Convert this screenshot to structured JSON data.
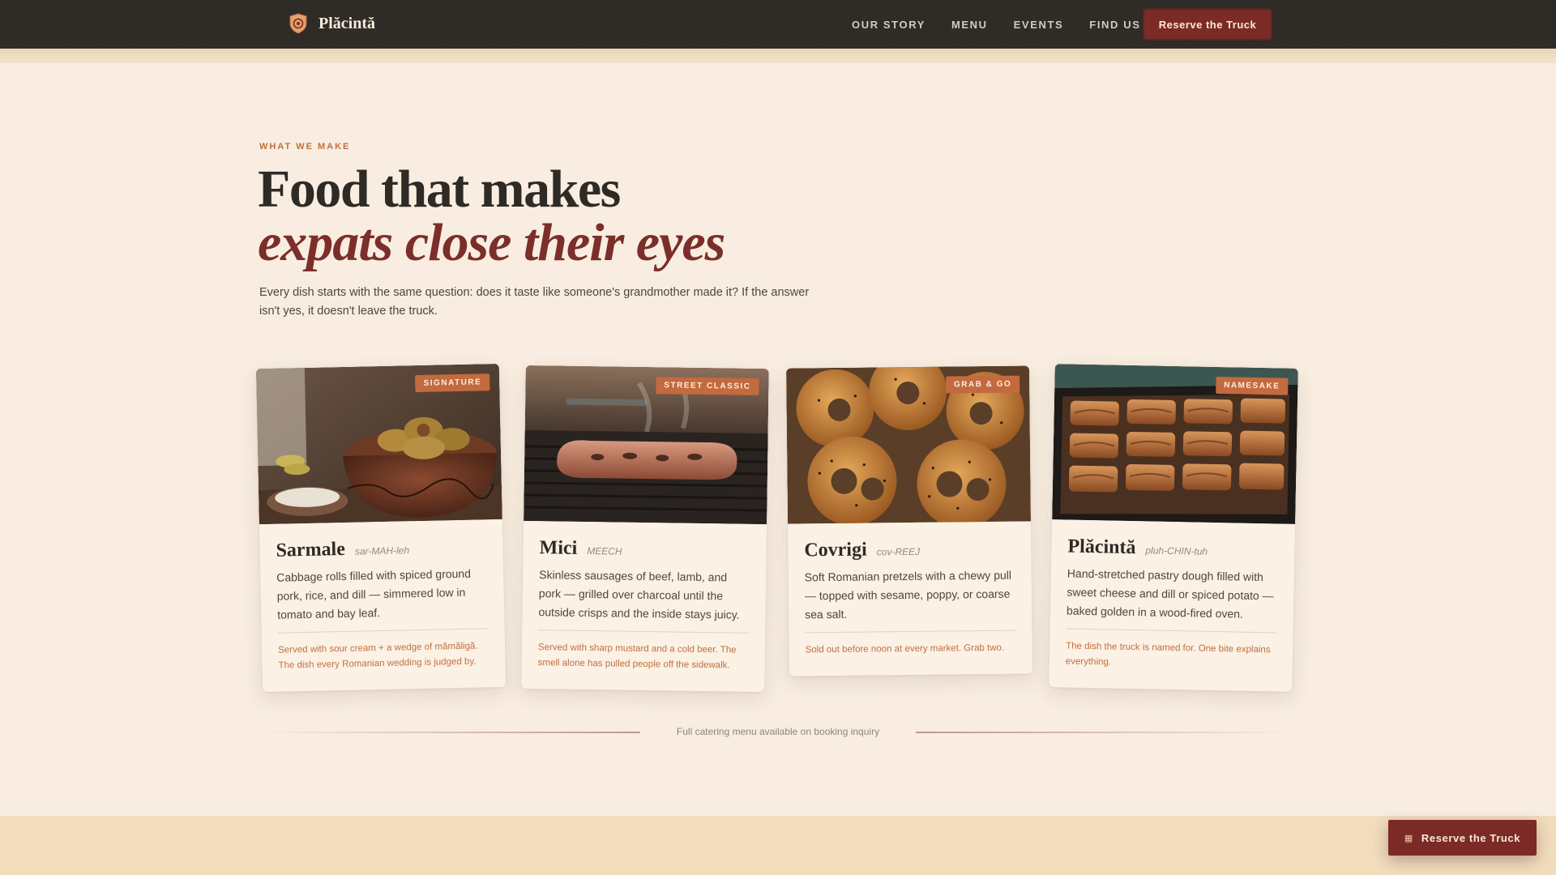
{
  "nav": {
    "brand": "Plăcintă",
    "logo_icon": "shield-logo-icon",
    "links": [
      "OUR STORY",
      "MENU",
      "EVENTS",
      "FIND US"
    ],
    "cta": "Reserve the Truck"
  },
  "header": {
    "eyebrow": "WHAT WE MAKE",
    "headline_line1": "Food that makes",
    "headline_line2": "expats close their eyes",
    "intro": "Every dish starts with the same question: does it taste like someone's grandmother made it? If the answer isn't yes, it doesn't leave the truck."
  },
  "cards": [
    {
      "badge": "SIGNATURE",
      "title": "Sarmale",
      "pronunciation": "sar-MAH-leh",
      "description": "Cabbage rolls filled with spiced ground pork, rice, and dill — simmered low in tomato and bay leaf.",
      "note": "Served with sour cream + a wedge of mămăligă. The dish every Romanian wedding is judged by."
    },
    {
      "badge": "STREET CLASSIC",
      "title": "Mici",
      "pronunciation": "MEECH",
      "description": "Skinless sausages of beef, lamb, and pork — grilled over charcoal until the outside crisps and the inside stays juicy.",
      "note": "Served with sharp mustard and a cold beer. The smell alone has pulled people off the sidewalk."
    },
    {
      "badge": "GRAB & GO",
      "title": "Covrigi",
      "pronunciation": "cov-REEJ",
      "description": "Soft Romanian pretzels with a chewy pull — topped with sesame, poppy, or coarse sea salt.",
      "note": "Sold out before noon at every market. Grab two."
    },
    {
      "badge": "NAMESAKE",
      "title": "Plăcintă",
      "pronunciation": "pluh-CHIN-tuh",
      "description": "Hand-stretched pastry dough filled with sweet cheese and dill or spiced potato — baked golden in a wood-fired oven.",
      "note": "The dish the truck is named for. One bite explains everything."
    }
  ],
  "footer": {
    "catering_note": "Full catering menu available on booking inquiry",
    "float_cta": "Reserve the Truck",
    "float_icon": "calendar-icon"
  },
  "colors": {
    "nav_bg": "#2f2b27",
    "page_bg": "#f8ede0",
    "accent_burgundy": "#7c2a26",
    "accent_terracotta": "#c36a3f"
  }
}
